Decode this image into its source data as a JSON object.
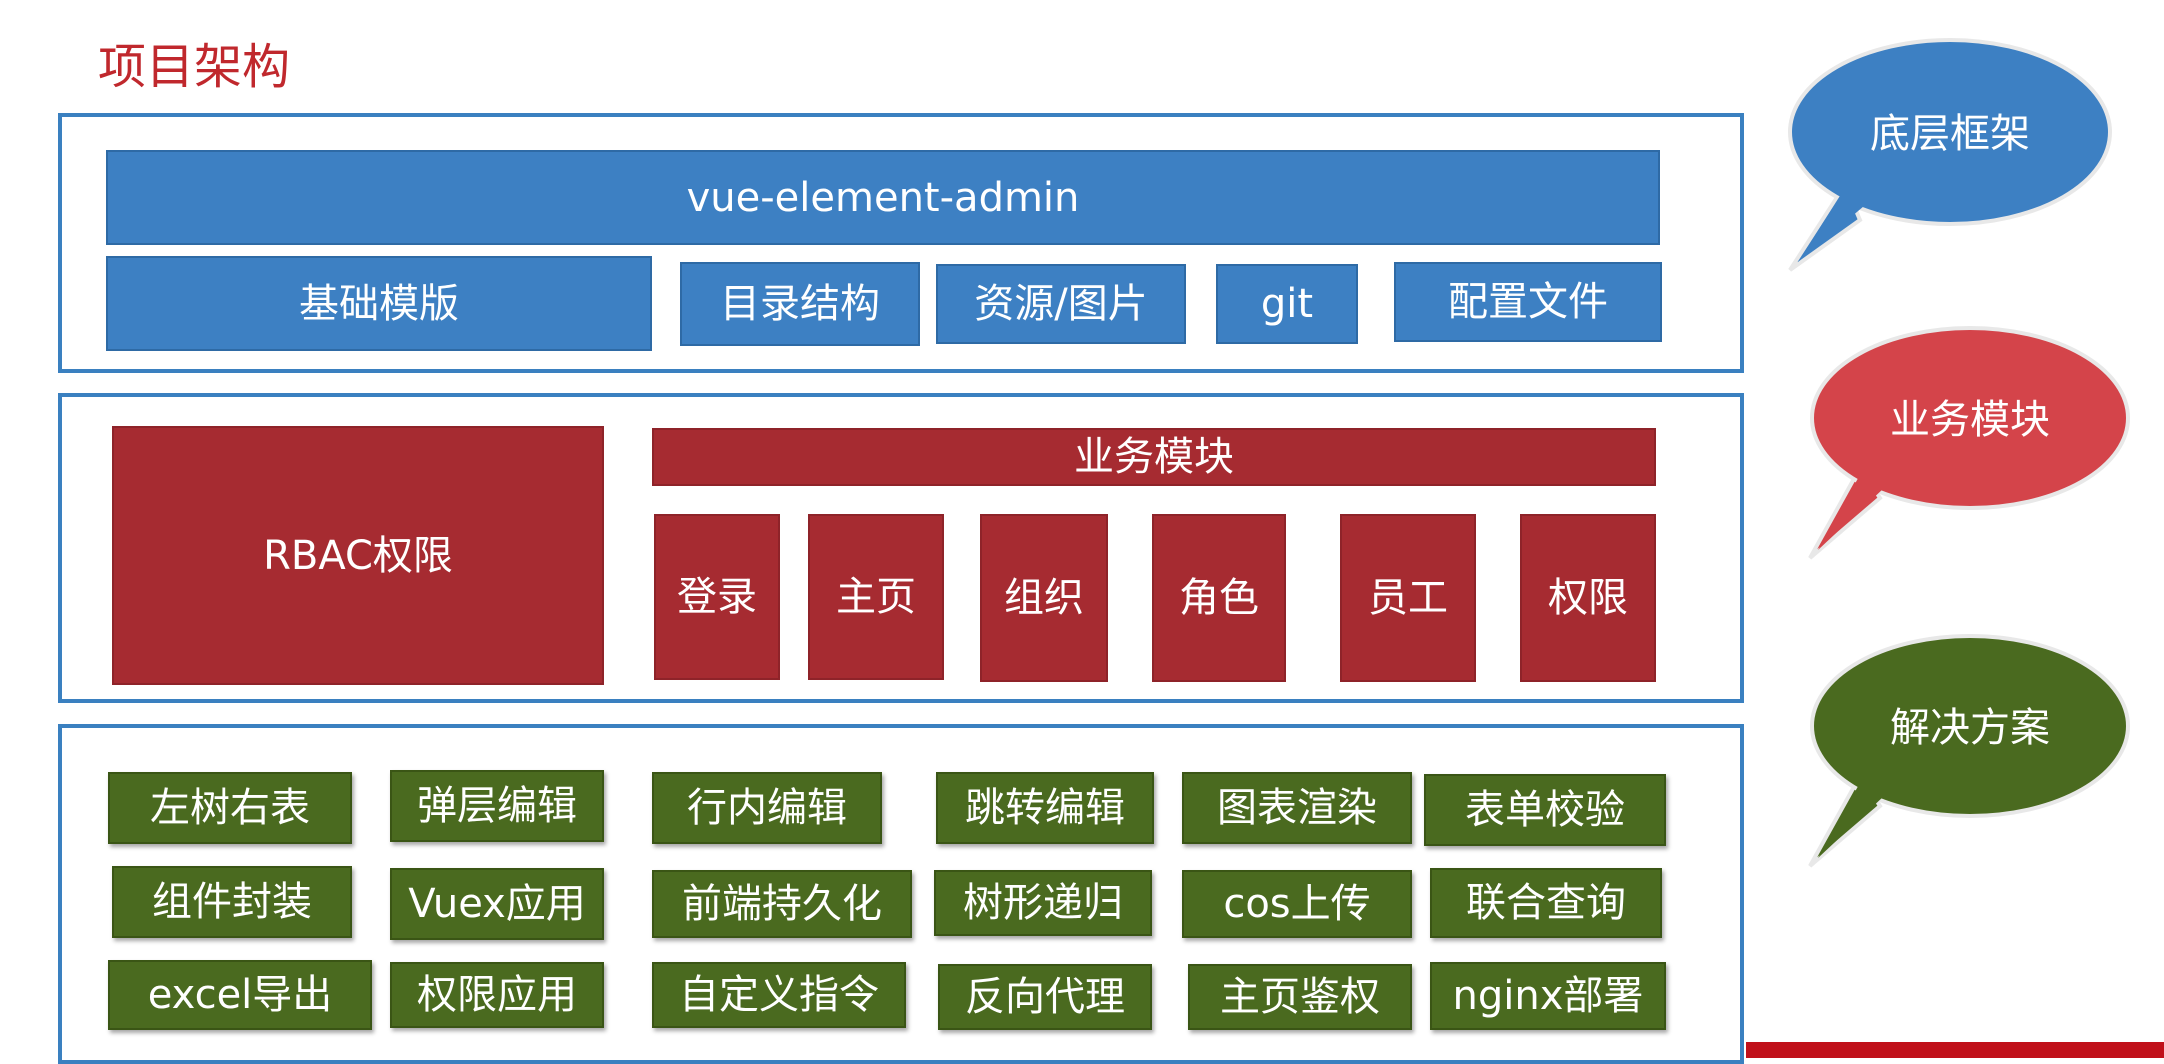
{
  "title": "项目架构",
  "foundation": {
    "header": "vue-element-admin",
    "items": [
      "基础模版",
      "目录结构",
      "资源/图片",
      "git",
      "配置文件"
    ]
  },
  "business": {
    "rbac": "RBAC权限",
    "header": "业务模块",
    "modules": [
      "登录",
      "主页",
      "组织",
      "角色",
      "员工",
      "权限"
    ]
  },
  "solutions": {
    "rows": [
      [
        "左树右表",
        "弹层编辑",
        "行内编辑",
        "跳转编辑",
        "图表渲染",
        "表单校验"
      ],
      [
        "组件封装",
        "Vuex应用",
        "前端持久化",
        "树形递归",
        "cos上传",
        "联合查询"
      ],
      [
        "excel导出",
        "权限应用",
        "自定义指令",
        "反向代理",
        "主页鉴权",
        "nginx部署"
      ]
    ]
  },
  "bubbles": {
    "foundation": "底层框架",
    "business": "业务模块",
    "solutions": "解决方案"
  },
  "colors": {
    "title": "#c0282d",
    "panel_border": "#3a80c0",
    "blue": "#3d80c3",
    "red": "#a62b31",
    "green": "#4a6a1f",
    "bubble_red": "#d4444a",
    "banner": "#c0101a"
  }
}
